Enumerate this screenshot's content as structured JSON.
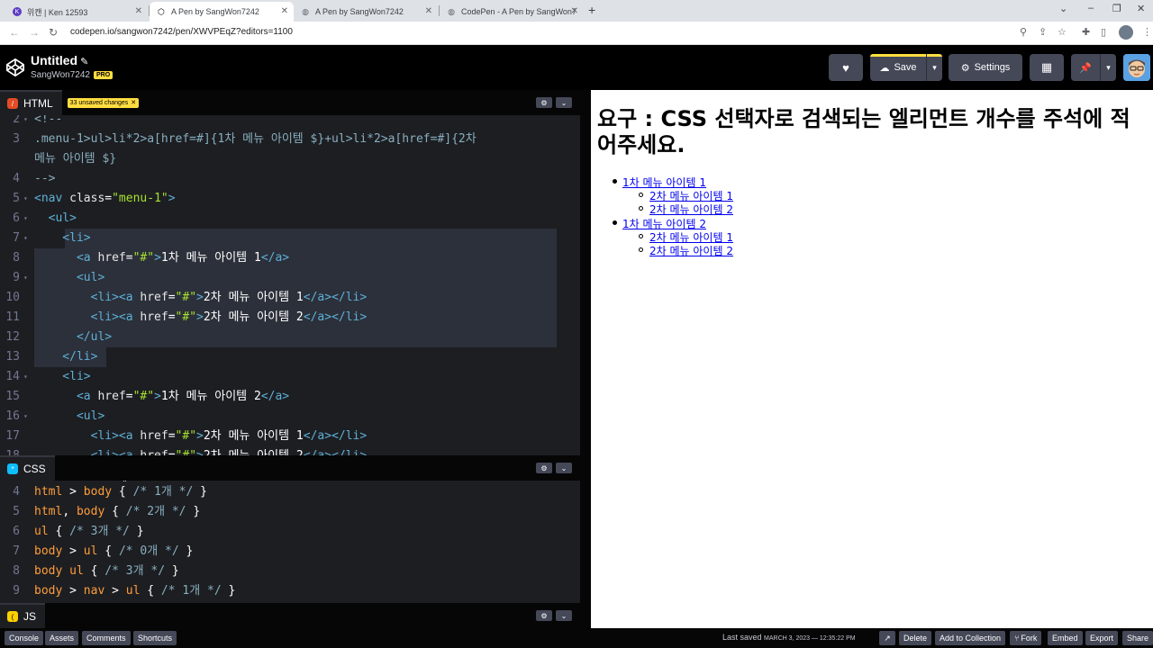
{
  "browser": {
    "tabs": [
      {
        "title": "위캔 | Ken 12593",
        "icon": "K"
      },
      {
        "title": "A Pen by SangWon7242",
        "icon": "codepen"
      },
      {
        "title": "A Pen by SangWon7242",
        "icon": "globe"
      },
      {
        "title": "CodePen - A Pen by SangWon7",
        "icon": "globe"
      }
    ],
    "url": "codepen.io/sangwon7242/pen/XWVPEqZ?editors=1100"
  },
  "header": {
    "title": "Untitled",
    "user": "SangWon7242",
    "pro_badge": "PRO",
    "save_label": "Save",
    "settings_label": "Settings"
  },
  "html_editor": {
    "tab_label": "HTML",
    "unsaved_badge": "33 unsaved changes",
    "lines": [
      {
        "n": "2",
        "fold": true
      },
      {
        "n": "3",
        "fold": false
      },
      {
        "n": "",
        "fold": false
      },
      {
        "n": "4",
        "fold": false
      },
      {
        "n": "5",
        "fold": true
      },
      {
        "n": "6",
        "fold": true
      },
      {
        "n": "7",
        "fold": true
      },
      {
        "n": "8",
        "fold": false
      },
      {
        "n": "9",
        "fold": true
      },
      {
        "n": "10",
        "fold": false
      },
      {
        "n": "11",
        "fold": false
      },
      {
        "n": "12",
        "fold": false
      },
      {
        "n": "13",
        "fold": false
      },
      {
        "n": "14",
        "fold": true
      },
      {
        "n": "15",
        "fold": false
      },
      {
        "n": "16",
        "fold": true
      },
      {
        "n": "17",
        "fold": false
      },
      {
        "n": "18",
        "fold": false
      }
    ]
  },
  "css_editor": {
    "tab_label": "CSS",
    "lines": [
      {
        "n": "4"
      },
      {
        "n": "5"
      },
      {
        "n": "6"
      },
      {
        "n": "7"
      },
      {
        "n": "8"
      },
      {
        "n": "9"
      }
    ]
  },
  "js_editor": {
    "tab_label": "JS"
  },
  "preview": {
    "heading": "요구 : CSS 선택자로 검색되는 엘리먼트 개수를 주석에 적어주세요.",
    "menu": [
      {
        "label": "1차 메뉴 아이템 1",
        "children": [
          "2차 메뉴 아이템 1",
          "2차 메뉴 아이템 2"
        ]
      },
      {
        "label": "1차 메뉴 아이템 2",
        "children": [
          "2차 메뉴 아이템 1",
          "2차 메뉴 아이템 2"
        ]
      }
    ]
  },
  "footer": {
    "console": "Console",
    "assets": "Assets",
    "comments": "Comments",
    "shortcuts": "Shortcuts",
    "last_saved_label": "Last saved",
    "last_saved_date": "MARCH 3, 2023 — 12:35:22 PM",
    "delete": "Delete",
    "add_collection": "Add to Collection",
    "fork": "Fork",
    "embed": "Embed",
    "export": "Export",
    "share": "Share"
  },
  "colors": {
    "tag": "#5db0d7",
    "attr": "#e6e6e6",
    "string": "#a6e22e",
    "comment": "#88afbf",
    "selector_orange": "#ff9e3b",
    "css_comment": "#88afbf",
    "accent_yellow": "#ffdd40"
  }
}
